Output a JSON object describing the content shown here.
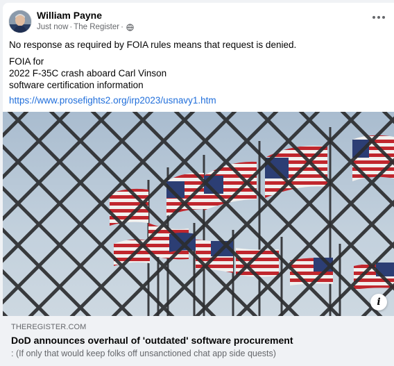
{
  "post": {
    "author": "William Payne",
    "time": "Just now",
    "separator1": "·",
    "group": "The Register",
    "separator2": "·",
    "audience_icon": "globe-icon",
    "menu_icon": "more-options-icon",
    "body_line1": "No response as required by FOIA rules means that request is denied.",
    "body_line2": "FOIA for",
    "body_line3": "2022 F-35C crash aboard Carl Vinson",
    "body_line4": "software certification information",
    "link": "https://www.prosefights2.org/irp2023/usnavy1.htm"
  },
  "preview": {
    "domain": "THEREGISTER.COM",
    "headline": "DoD announces overhaul of 'outdated' software procurement",
    "description": ": (If only that would keep folks off unsanctioned chat app side quests)",
    "info_label": "i",
    "info_icon": "info-icon"
  },
  "colors": {
    "link": "#216fdb",
    "secondary_text": "#65676b",
    "preview_bg": "#f0f2f5",
    "sky": "#b7c8d8"
  }
}
